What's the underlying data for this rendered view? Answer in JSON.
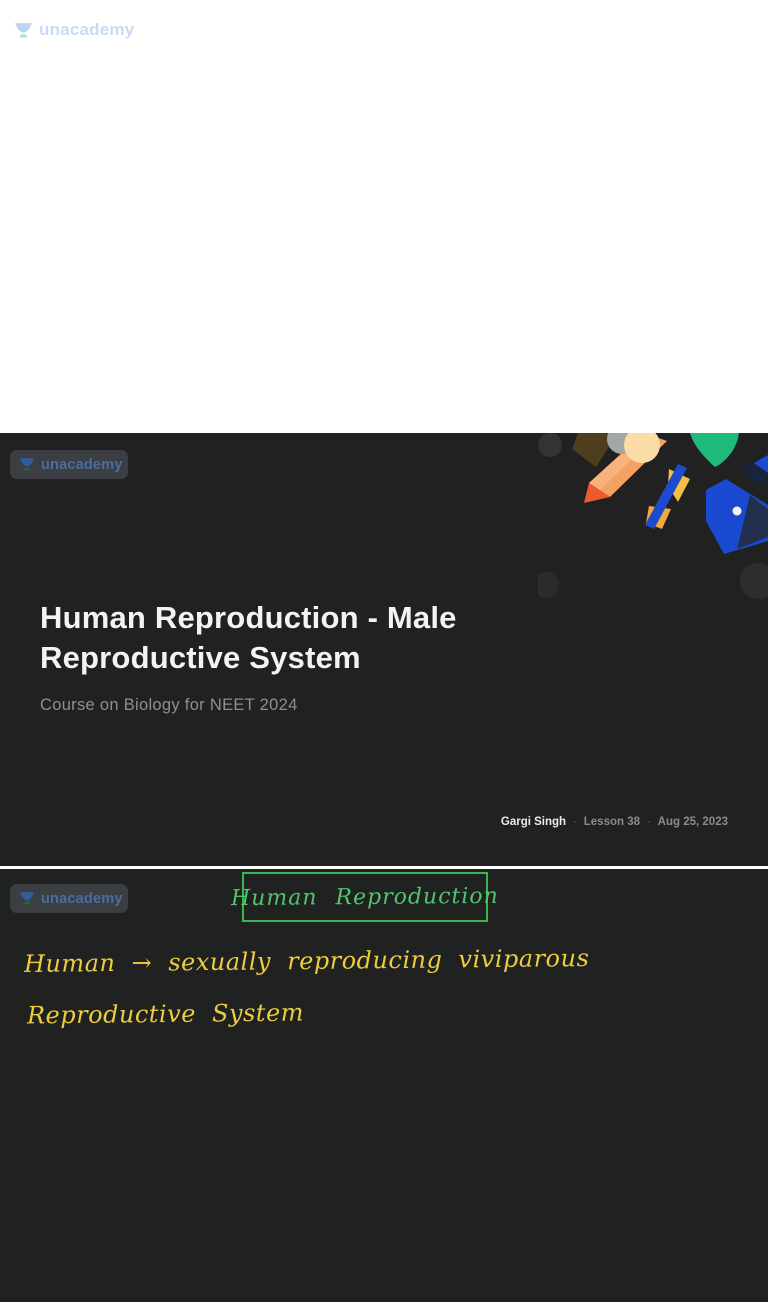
{
  "brand": {
    "wordmark": "unacademy"
  },
  "slide2": {
    "title_lines": [
      "Human Reproduction - Male",
      "Reproductive System"
    ],
    "subtitle": "Course on Biology for NEET 2024",
    "meta": {
      "author": "Gargi Singh",
      "separator": "·",
      "lesson": "Lesson 38",
      "date": "Aug 25, 2023"
    }
  },
  "slide3": {
    "boxed_heading": "Human Reproduction",
    "note_line1": "Human → sexually reproducing viviparous",
    "note_line2": "Reproductive System"
  },
  "colors": {
    "slide_dark_bg": "#212121",
    "accent_green_border": "#3bb34e",
    "handwriting_green": "#53c46d",
    "handwriting_yellow": "#eecd3d",
    "brand_blue_dim": "#4a6da0",
    "brand_blue_light": "#c9dbf2",
    "title_white": "#f3f3f3",
    "subtitle_gray": "#8f8f8f"
  }
}
